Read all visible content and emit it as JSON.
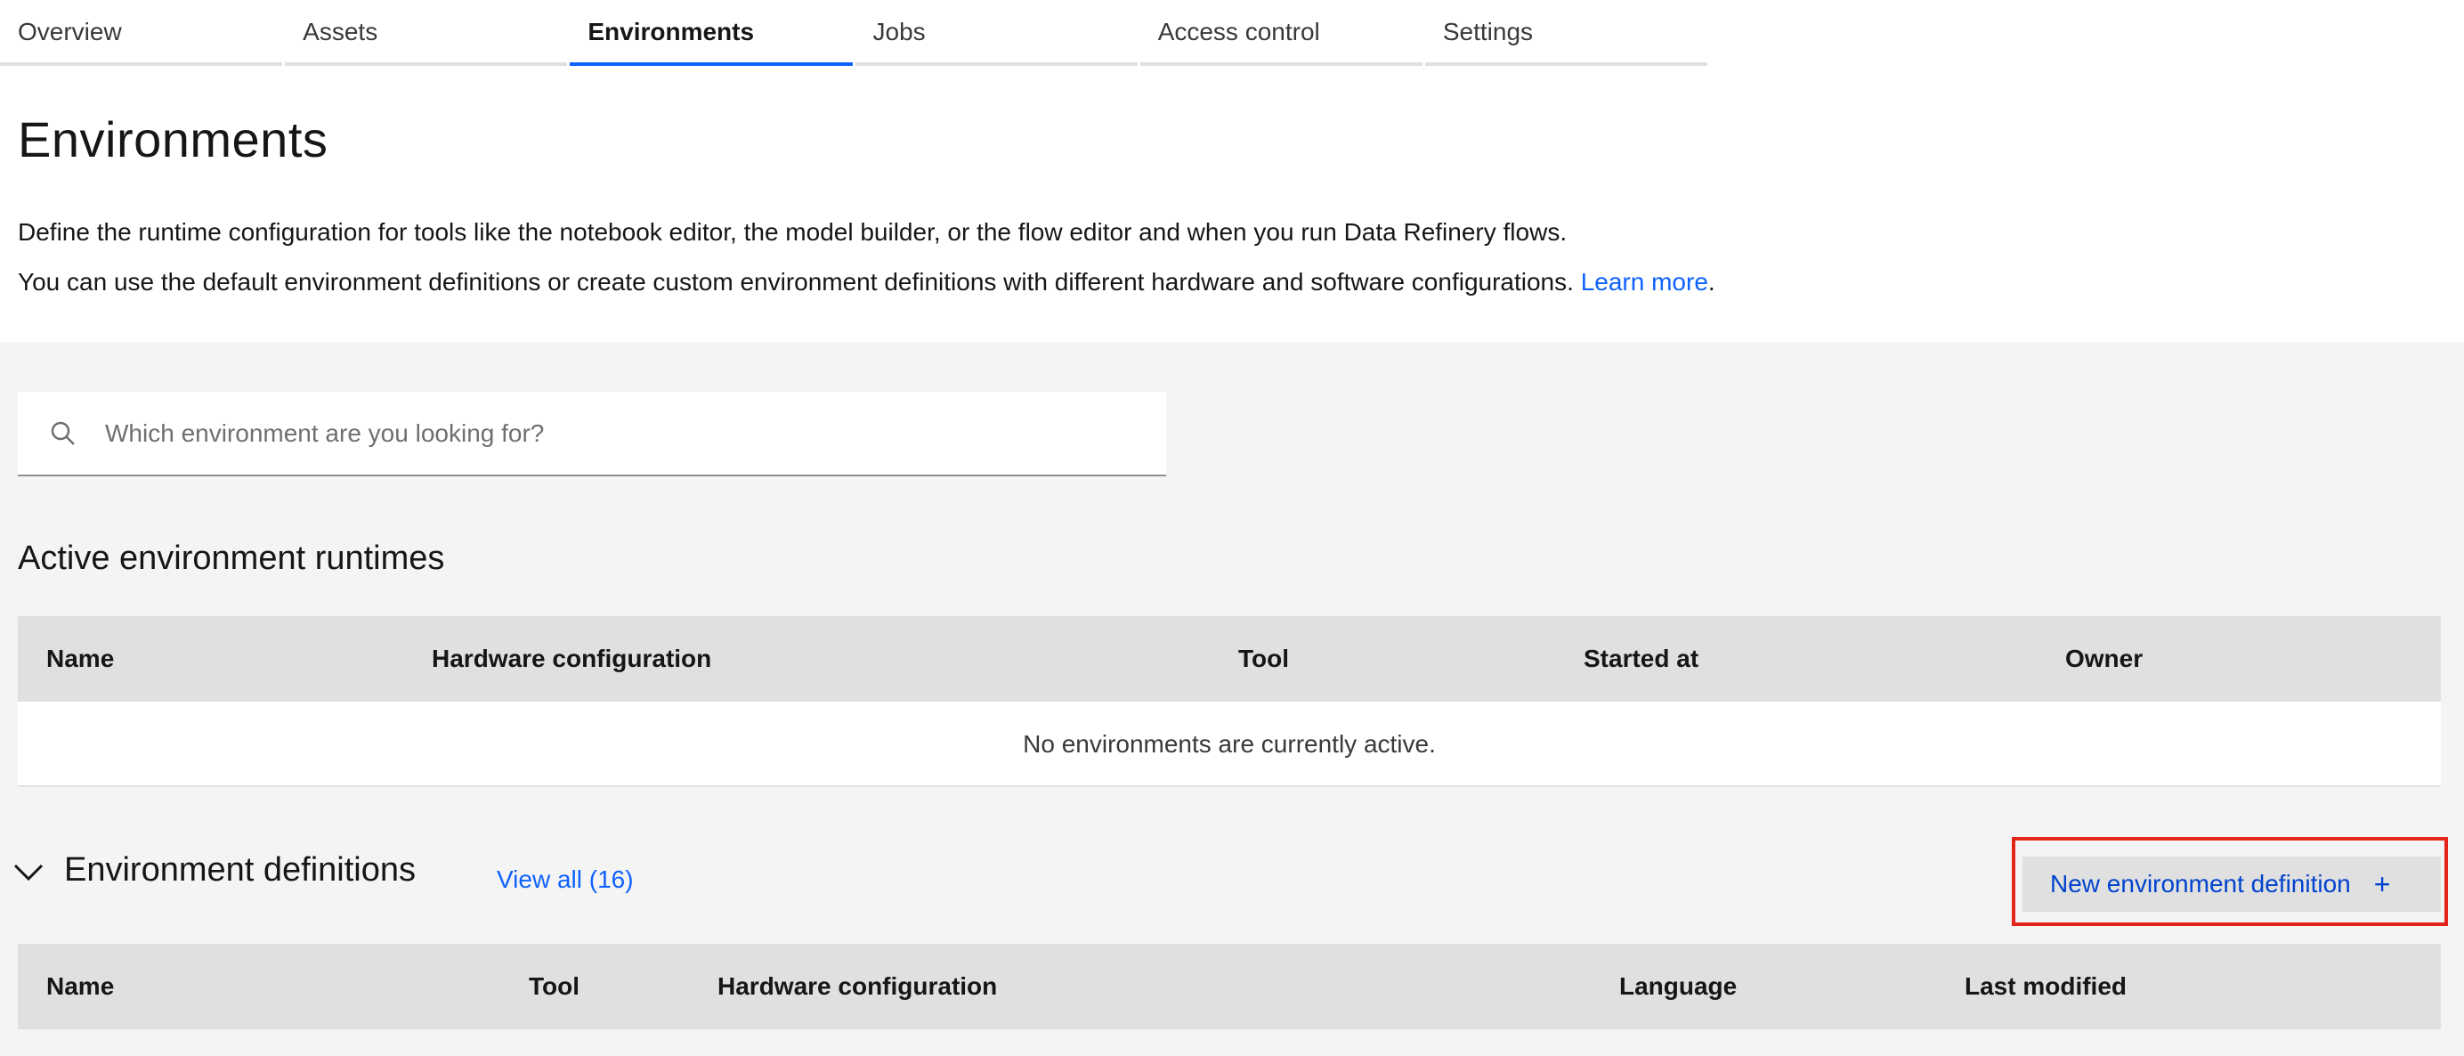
{
  "tabs": [
    {
      "label": "Overview",
      "active": false
    },
    {
      "label": "Assets",
      "active": false
    },
    {
      "label": "Environments",
      "active": true
    },
    {
      "label": "Jobs",
      "active": false
    },
    {
      "label": "Access control",
      "active": false
    },
    {
      "label": "Settings",
      "active": false
    }
  ],
  "page": {
    "title": "Environments",
    "desc1": "Define the runtime configuration for tools like the notebook editor, the model builder, or the flow editor and when you run Data Refinery flows.",
    "desc2": "You can use the default environment definitions or create custom environment definitions with different hardware and software configurations.",
    "learn_more": "Learn more",
    "period": "."
  },
  "search": {
    "placeholder": "Which environment are you looking for?"
  },
  "active_runtimes": {
    "title": "Active environment runtimes",
    "columns": [
      "Name",
      "Hardware configuration",
      "Tool",
      "Started at",
      "Owner"
    ],
    "empty_message": "No environments are currently active."
  },
  "definitions": {
    "title": "Environment definitions",
    "view_all": "View all (16)",
    "new_button": "New environment definition",
    "plus": "+",
    "columns": [
      "Name",
      "Tool",
      "Hardware configuration",
      "Language",
      "Last modified"
    ]
  },
  "colors": {
    "accent": "#0f62fe",
    "highlight": "#e3241b"
  }
}
